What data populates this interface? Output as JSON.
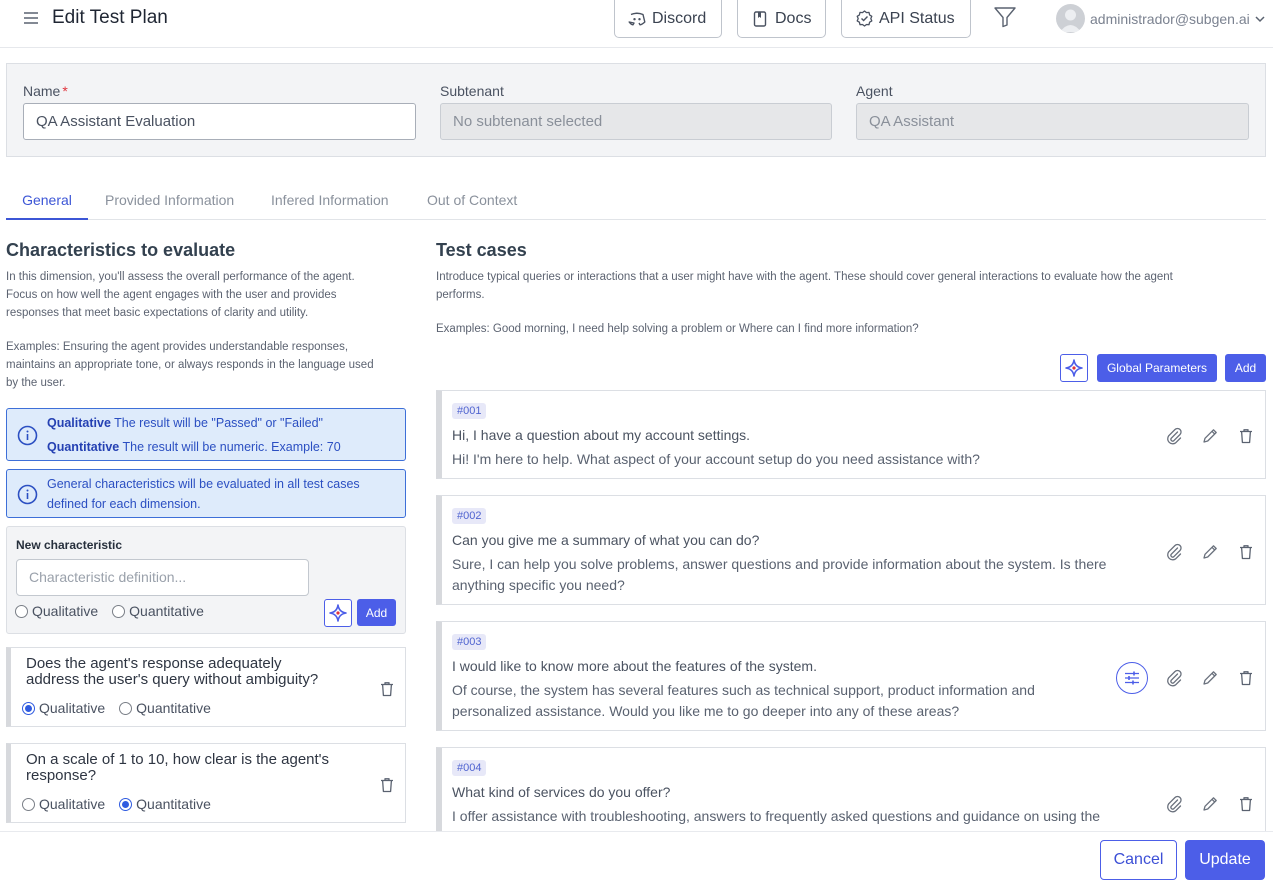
{
  "header": {
    "title": "Edit Test Plan",
    "buttons": [
      {
        "label": "Discord",
        "icon": "discord-icon"
      },
      {
        "label": "Docs",
        "icon": "book-icon"
      },
      {
        "label": "API Status",
        "icon": "check-badge-icon"
      }
    ],
    "user_email": "administrador@subgen.ai"
  },
  "form": {
    "name_label": "Name",
    "name_required_mark": "*",
    "name_value": "QA Assistant Evaluation",
    "subtenant_label": "Subtenant",
    "subtenant_value": "No subtenant selected",
    "agent_label": "Agent",
    "agent_value": "QA Assistant"
  },
  "tabs": [
    {
      "label": "General",
      "active": true
    },
    {
      "label": "Provided Information",
      "active": false
    },
    {
      "label": "Infered Information",
      "active": false
    },
    {
      "label": "Out of Context",
      "active": false
    }
  ],
  "characteristics": {
    "title": "Characteristics to evaluate",
    "desc_1": "In this dimension, you'll assess the overall performance of the agent.",
    "desc_2": "Focus on how well the agent engages with the user and provides",
    "desc_3": "responses that meet basic expectations of clarity and utility.",
    "desc_4": "Examples: Ensuring the agent provides understandable responses,",
    "desc_5": "maintains an appropriate tone, or always responds in the language used",
    "desc_6": "by the user.",
    "info_qualitative_bold": "Qualitative",
    "info_qualitative_text": "The result will be \"Passed\" or \"Failed\"",
    "info_quantitative_bold": "Quantitative",
    "info_quantitative_text": "The result will be numeric. Example: 70",
    "info_general_1": "General characteristics will be evaluated in all test cases",
    "info_general_2": "defined for each dimension.",
    "new_title": "New characteristic",
    "new_placeholder": "Characteristic definition...",
    "opt_qualitative": "Qualitative",
    "opt_quantitative": "Quantitative",
    "add_label": "Add",
    "items": [
      {
        "line1": "Does the agent's response adequately",
        "line2": "address the user's query without ambiguity?",
        "selected": "Qualitative"
      },
      {
        "line1": "On a scale of 1 to 10, how clear is the agent's",
        "line2": "response?",
        "selected": "Quantitative"
      }
    ]
  },
  "test_cases": {
    "title": "Test cases",
    "desc_1": "Introduce typical queries or interactions that a user might have with the agent. These should cover general interactions to evaluate how the agent",
    "desc_2": "performs.",
    "desc_3": "Examples: Good morning, I need help solving a problem or Where can I find more information?",
    "global_params_label": "Global Parameters",
    "add_label": "Add",
    "items": [
      {
        "id": "#001",
        "question": "Hi, I have a question about my account settings.",
        "answer_1": "Hi! I'm here to help. What aspect of your account setup do you need assistance with?",
        "answer_2": ""
      },
      {
        "id": "#002",
        "question": "Can you give me a summary of what you can do?",
        "answer_1": "Sure, I can help you solve problems, answer questions and provide information about the system. Is there",
        "answer_2": "anything specific you need?"
      },
      {
        "id": "#003",
        "question": "I would like to know more about the features of the system.",
        "answer_1": "Of course, the system has several features such as technical support, product information and",
        "answer_2": "personalized assistance. Would you like me to go deeper into any of these areas?"
      },
      {
        "id": "#004",
        "question": "What kind of services do you offer?",
        "answer_1": "I offer assistance with troubleshooting, answers to frequently asked questions and guidance on using the",
        "answer_2": ""
      }
    ]
  },
  "footer": {
    "cancel_label": "Cancel",
    "update_label": "Update"
  },
  "colors": {
    "primary": "#4c5ee8",
    "info_bg": "#deebfb",
    "info_border": "#3d6fd8",
    "required": "#e0343d"
  }
}
